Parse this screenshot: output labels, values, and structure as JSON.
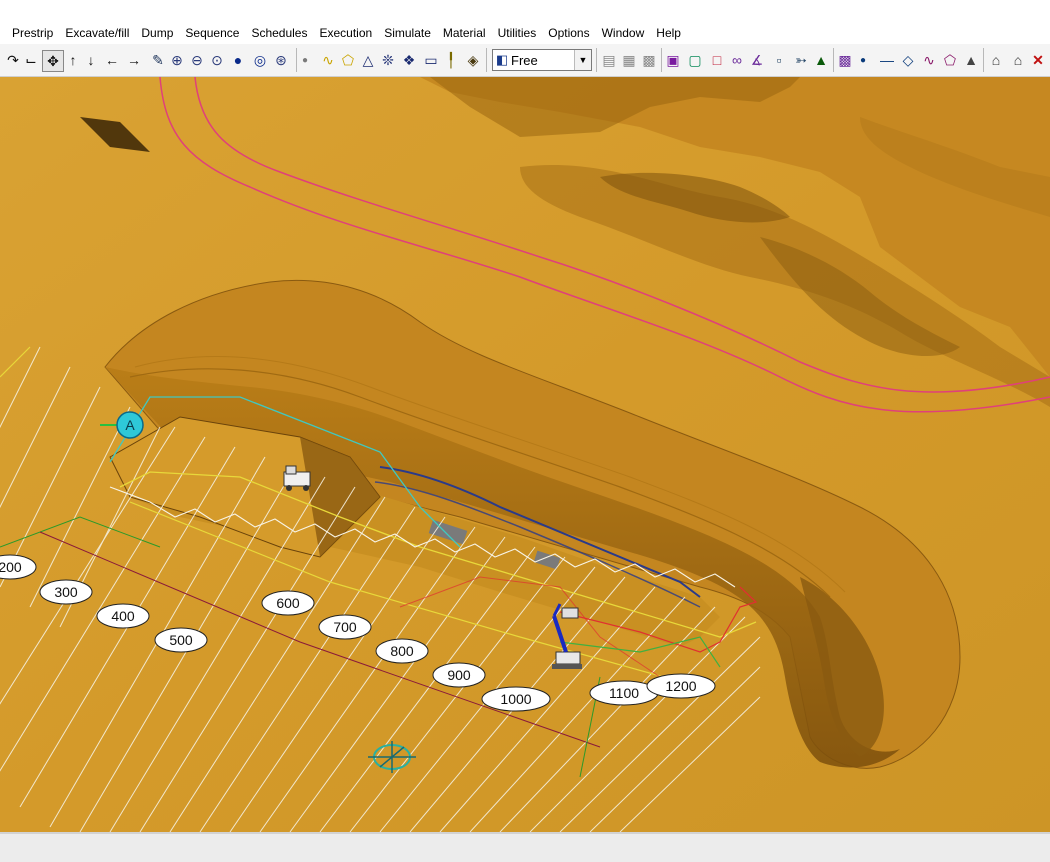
{
  "menu": [
    "Prestrip",
    "Excavate/fill",
    "Dump",
    "Sequence",
    "Schedules",
    "Execution",
    "Simulate",
    "Material",
    "Utilities",
    "Options",
    "Window",
    "Help"
  ],
  "toolbar": {
    "view_mode": "Free",
    "icons": [
      "select-cursor-icon",
      "axis-icon",
      "pan-icon",
      "arrow-up-icon",
      "arrow-down-icon",
      "arrow-left-icon",
      "arrow-right-icon",
      "pencil-icon",
      "zoom-in-icon",
      "zoom-out-icon",
      "zoom-window-icon",
      "sphere-icon",
      "target-icon",
      "zoom-extents-icon",
      "point-icon",
      "polyline-icon",
      "polygon-icon",
      "triangle-icon",
      "solid-icon",
      "diamond-icon",
      "rectangle-icon",
      "profile-icon",
      "compass-icon"
    ]
  },
  "scene": {
    "marker_label": "A",
    "chainage_labels": [
      "200",
      "300",
      "400",
      "500",
      "600",
      "700",
      "800",
      "900",
      "1000",
      "1100",
      "1200"
    ],
    "colors": {
      "terrain": "#d49a2a",
      "pit": "#b07410",
      "boundary": "#e0407a",
      "strings": "#f5f0e0"
    }
  }
}
